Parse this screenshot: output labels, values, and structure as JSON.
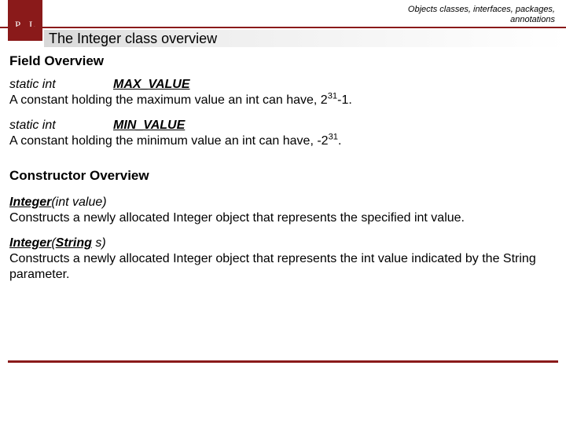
{
  "header": {
    "topic_line1": "Objects classes, interfaces, packages,",
    "topic_line2": "annotations",
    "logo_letters": "P   L",
    "title": "The Integer class overview"
  },
  "sections": {
    "fields_heading": "Field Overview",
    "constructors_heading": "Constructor Overview"
  },
  "fields": [
    {
      "type": "static int",
      "name": "MAX_VALUE",
      "desc_pre": "A constant holding the maximum value an int can have, 2",
      "exp": "31",
      "desc_post": "-1."
    },
    {
      "type": "static int",
      "name": "MIN_VALUE",
      "desc_pre": "A constant holding the minimum value an int can have, -2",
      "exp": "31",
      "desc_post": "."
    }
  ],
  "constructors": [
    {
      "link": "Integer",
      "params": "(int value)",
      "desc": "Constructs a newly allocated Integer object that represents the specified int value."
    },
    {
      "link": "Integer",
      "param_open": "(",
      "param_type_link": "String",
      "param_rest": " s)",
      "desc": "Constructs a newly allocated Integer object that represents the int value indicated by the String parameter."
    }
  ]
}
